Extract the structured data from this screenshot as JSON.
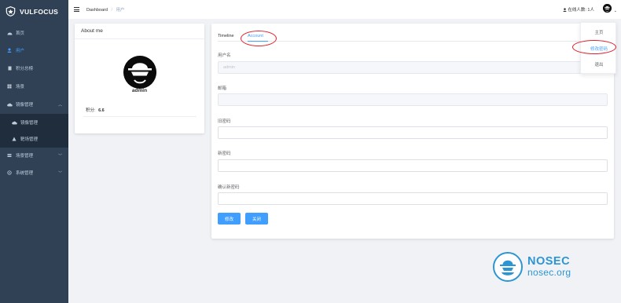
{
  "brand": {
    "name": "VULFOCUS"
  },
  "sidebar": {
    "items": [
      {
        "label": "首页",
        "icon": "dashboard-icon"
      },
      {
        "label": "用户",
        "icon": "user-icon",
        "active": true
      },
      {
        "label": "积分总榜",
        "icon": "document-icon"
      },
      {
        "label": "场景",
        "icon": "grid-icon"
      },
      {
        "label": "镜像管理",
        "icon": "cloud-icon",
        "expanded": true
      },
      {
        "label": "镜像管理",
        "icon": "cloud-icon",
        "sub": true
      },
      {
        "label": "靶场管理",
        "icon": "target-icon",
        "sub": true
      },
      {
        "label": "场景管理",
        "icon": "layers-icon"
      },
      {
        "label": "系统管理",
        "icon": "gear-icon"
      }
    ]
  },
  "header": {
    "breadcrumb": [
      "Dashboard",
      "用户"
    ],
    "online_text": "在线人数: 1人"
  },
  "about": {
    "title": "About me",
    "username": "admin",
    "points_label": "积分:",
    "points_value": "6.6"
  },
  "tabs": [
    {
      "label": "Timeline"
    },
    {
      "label": "Account",
      "active": true
    }
  ],
  "form": {
    "username_label": "用户名",
    "username_value": "admin",
    "email_label": "邮箱",
    "old_password_label": "旧密码",
    "new_password_label": "新密码",
    "confirm_password_label": "确认新密码",
    "submit_label": "修改",
    "close_label": "关闭"
  },
  "dropdown": {
    "items": [
      "主页",
      "修改密码",
      "退出"
    ]
  },
  "watermark": {
    "title": "NOSEC",
    "subtitle": "nosec.org"
  },
  "colors": {
    "sidebar": "#304156",
    "accent": "#409eff",
    "annotation": "#e0202a",
    "watermark": "#2c95d4"
  }
}
